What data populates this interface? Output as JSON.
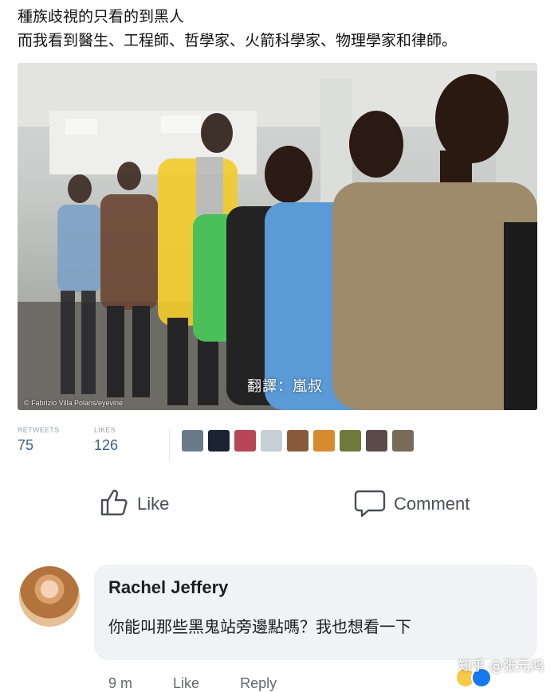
{
  "caption": {
    "line1": "種族歧視的只看的到黑人",
    "line2": "而我看到醫生、工程師、哲學家、火箭科學家、物理學家和律師。"
  },
  "photo": {
    "credit": "© Fabrizio Villa Polaris/eyevine",
    "translator": "翻譯：嵐叔"
  },
  "stats": {
    "retweets_label": "RETWEETS",
    "retweets_value": "75",
    "likes_label": "LIKES",
    "likes_value": "126"
  },
  "actions": {
    "like_label": "Like",
    "comment_label": "Comment"
  },
  "comment": {
    "author": "Rachel Jeffery",
    "text": "你能叫那些黑鬼站旁邊點嗎？我也想看一下",
    "time": "9 m",
    "like_label": "Like",
    "reply_label": "Reply"
  },
  "watermark": "知乎 @张元鸿",
  "colors": {
    "accent_blue": "#3b5f86",
    "bubble_bg": "#f0f2f5"
  }
}
